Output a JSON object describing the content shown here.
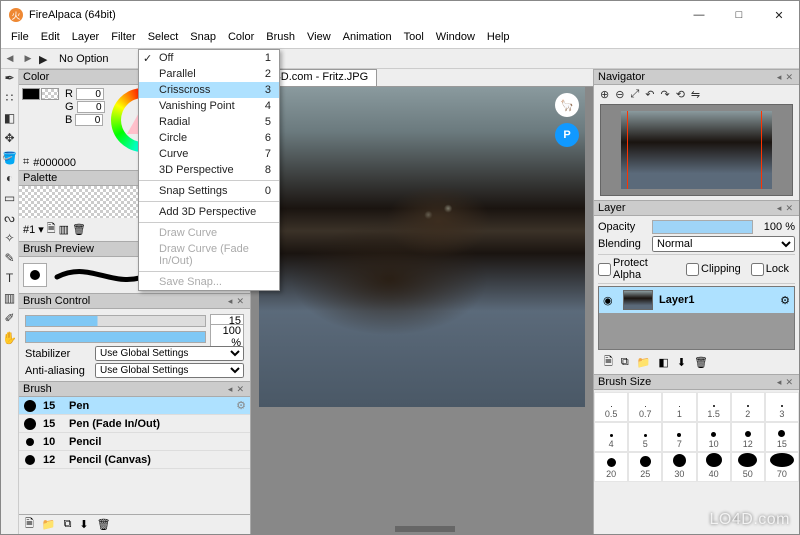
{
  "title": "FireAlpaca (64bit)",
  "window_buttons": {
    "min": "—",
    "max": "□",
    "close": "✕"
  },
  "menubar": [
    "File",
    "Edit",
    "Layer",
    "Filter",
    "Select",
    "Snap",
    "Color",
    "Brush",
    "View",
    "Animation",
    "Tool",
    "Window",
    "Help"
  ],
  "optionbar": {
    "label": "No Option"
  },
  "tab": "LO4D.com - Fritz.JPG",
  "snap_menu": {
    "items": [
      {
        "label": "Off",
        "key": "1",
        "checked": true
      },
      {
        "label": "Parallel",
        "key": "2"
      },
      {
        "label": "Crisscross",
        "key": "3",
        "hover": true
      },
      {
        "label": "Vanishing Point",
        "key": "4"
      },
      {
        "label": "Radial",
        "key": "5"
      },
      {
        "label": "Circle",
        "key": "6"
      },
      {
        "label": "Curve",
        "key": "7"
      },
      {
        "label": "3D Perspective",
        "key": "8"
      }
    ],
    "sep1": true,
    "settings": {
      "label": "Snap Settings",
      "key": "0"
    },
    "sep2": true,
    "add3d": "Add 3D Perspective",
    "sep3": true,
    "drawcurve": "Draw Curve",
    "drawcurve2": "Draw Curve (Fade In/Out)",
    "sep4": true,
    "savesnap": "Save Snap..."
  },
  "color": {
    "title": "Color",
    "r": "0",
    "g": "0",
    "b": "0",
    "hex": "#000000"
  },
  "palette": {
    "title": "Palette",
    "preset": "#1"
  },
  "brush_preview": {
    "title": "Brush Preview"
  },
  "brush_control": {
    "title": "Brush Control",
    "size": "15",
    "opacity": "100 %",
    "stabilizer_label": "Stabilizer",
    "stabilizer_value": "Use Global Settings",
    "aa_label": "Anti-aliasing",
    "aa_value": "Use Global Settings"
  },
  "brush": {
    "title": "Brush",
    "items": [
      {
        "size": "15",
        "name": "Pen",
        "sel": true,
        "d": 12
      },
      {
        "size": "15",
        "name": "Pen (Fade In/Out)",
        "d": 12
      },
      {
        "size": "10",
        "name": "Pencil",
        "d": 8
      },
      {
        "size": "12",
        "name": "Pencil (Canvas)",
        "d": 10
      }
    ]
  },
  "navigator": {
    "title": "Navigator"
  },
  "layer": {
    "title": "Layer",
    "opacity_label": "Opacity",
    "opacity": "100 %",
    "blend_label": "Blending",
    "blend_value": "Normal",
    "protect": "Protect Alpha",
    "clip": "Clipping",
    "lock": "Lock",
    "layername": "Layer1"
  },
  "brush_size": {
    "title": "Brush Size",
    "row1": [
      "0.5",
      "0.7",
      "1",
      "1.5",
      "2",
      "3"
    ],
    "row2": [
      "4",
      "5",
      "7",
      "10",
      "12",
      "15"
    ],
    "row3": [
      "20",
      "25",
      "30",
      "40",
      "50",
      "70"
    ]
  },
  "watermark": "LO4D.com",
  "icons": {
    "doc": "🗎",
    "folder": "📁",
    "dup": "⧉",
    "dl": "⬇",
    "trash": "🗑",
    "gear": "⚙",
    "eye": "👁"
  }
}
